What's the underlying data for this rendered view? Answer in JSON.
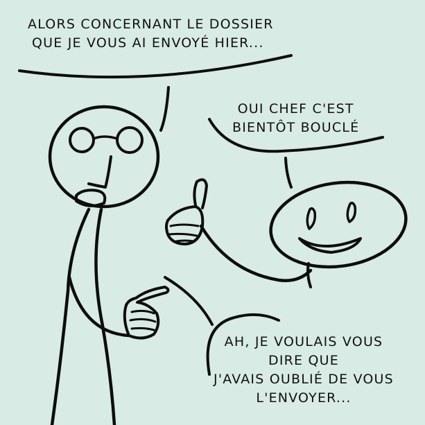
{
  "colors": {
    "background": "#d8ebe4",
    "ink": "#0d0d0d"
  },
  "speech": {
    "boss": {
      "line1": "ALORS CONCERNANT LE DOSSIER",
      "line2": "QUE JE VOUS AI ENVOYÉ HIER..."
    },
    "employee_reply": {
      "line1": "OUI CHEF C'EST",
      "line2": "BIENTÔT BOUCLÉ"
    },
    "employee_confession": {
      "line1": "AH, JE VOULAIS VOUS",
      "line2": "DIRE QUE",
      "line3": "J'AVAIS OUBLIÉ DE VOUS",
      "line4": "L'ENVOYER..."
    }
  }
}
